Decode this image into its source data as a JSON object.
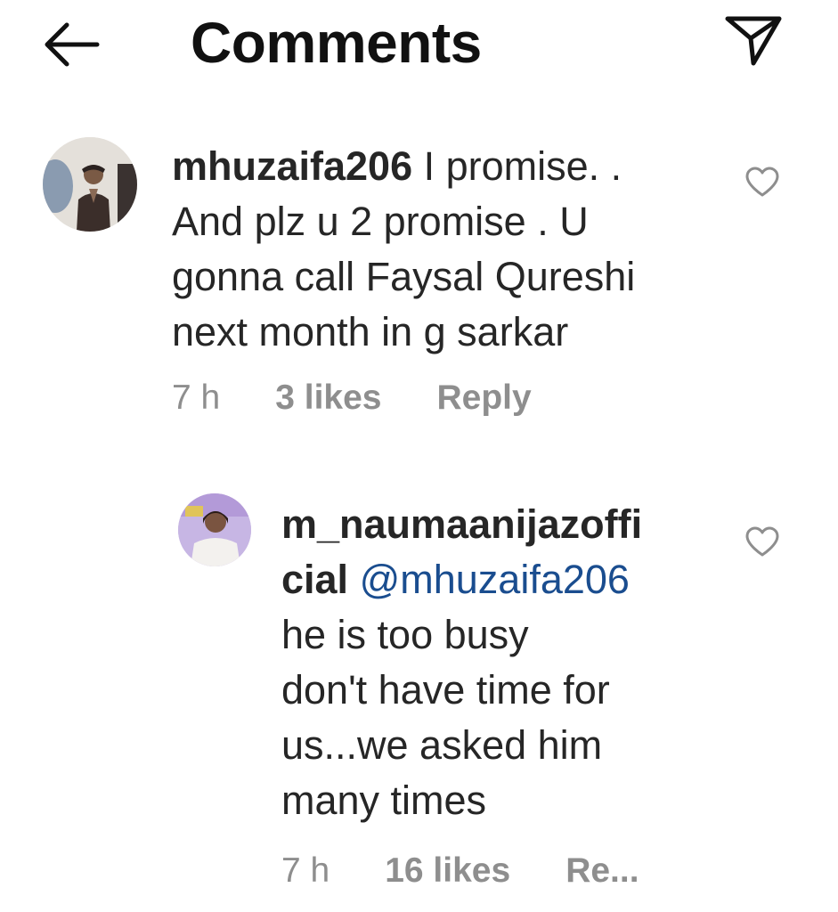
{
  "header": {
    "title": "Comments"
  },
  "icons": {
    "back": "arrow-left-icon",
    "share": "paper-plane-icon",
    "like": "heart-outline-icon"
  },
  "comments": [
    {
      "username": "mhuzaifa206",
      "text_line1": " I promise. .",
      "text_line2": "And plz u 2 promise . U",
      "text_line3": "gonna call Faysal Qureshi",
      "text_line4": "next month in g sarkar",
      "time": "7 h",
      "likes": "3 likes",
      "reply": "Reply"
    },
    {
      "username_line1": "m_naumaanijazoffi",
      "username_line2": "cial",
      "mention": "@mhuzaifa206",
      "text_line1": "he is too busy",
      "text_line2": "don't have time for",
      "text_line3": "us...we asked him",
      "text_line4": "many times",
      "time": "7 h",
      "likes": "16 likes",
      "reply": "Re..."
    }
  ],
  "colors": {
    "text": "#262626",
    "meta": "#8e8e8e",
    "mention": "#1a4d8f"
  }
}
